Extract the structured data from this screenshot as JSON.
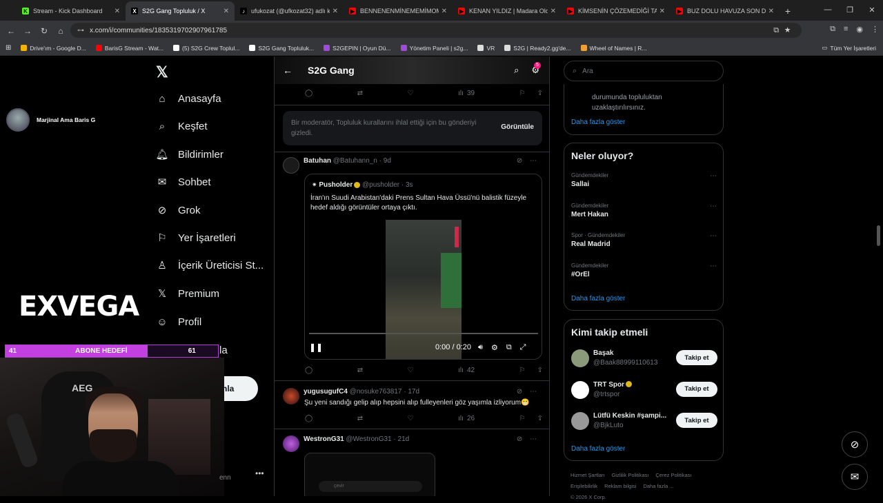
{
  "tabs": [
    {
      "title": "Stream - Kick Dashboard",
      "fav_color": "#53fc18",
      "fav_glyph": "K"
    },
    {
      "title": "S2G Gang Topluluk / X",
      "fav_color": "#000000",
      "fav_glyph": "X"
    },
    {
      "title": "ufukozat (@ufkozat32) adlı kul",
      "fav_color": "#000000",
      "fav_glyph": "♪"
    },
    {
      "title": "BENNENENMİNEMEMİMOMAN",
      "fav_color": "#ff0000",
      "fav_glyph": "▶"
    },
    {
      "title": "KENAN YILDIZ | Madara Olduk",
      "fav_color": "#ff0000",
      "fav_glyph": "▶"
    },
    {
      "title": "KİMSENİN ÇÖZEMEDİĞİ TARİH",
      "fav_color": "#ff0000",
      "fav_glyph": "▶"
    },
    {
      "title": "BUZ DOLU HAVUZA SON DÜŞ",
      "fav_color": "#ff0000",
      "fav_glyph": "▶"
    }
  ],
  "address": "x.com/i/communities/1835319702907961785",
  "bookmarks": [
    {
      "label": "Drive'ım - Google D...",
      "color": "#f4b400"
    },
    {
      "label": "BarisG Stream - Wat...",
      "color": "#ff0000"
    },
    {
      "label": "(5) S2G Crew Toplul...",
      "color": "#ffffff"
    },
    {
      "label": "S2G Gang Topluluk...",
      "color": "#ffffff"
    },
    {
      "label": "S2GEPIN | Oyun Dü...",
      "color": "#a04cd8"
    },
    {
      "label": "Yönetim Paneli | s2g...",
      "color": "#a04cd8"
    },
    {
      "label": "VR",
      "color": "#dddddd"
    },
    {
      "label": "S2G | Ready2.gg'de...",
      "color": "#dddddd"
    },
    {
      "label": "Wheel of Names | R...",
      "color": "#f0a030"
    }
  ],
  "bookmarks_all": "Tüm Yer İşaretleri",
  "nav": [
    {
      "label": "Anasayfa",
      "icon": "⌂",
      "name": "home"
    },
    {
      "label": "Keşfet",
      "icon": "⌕",
      "name": "explore"
    },
    {
      "label": "Bildirimler",
      "icon": "🔔︎",
      "name": "notifications"
    },
    {
      "label": "Sohbet",
      "icon": "✉",
      "name": "chat"
    },
    {
      "label": "Grok",
      "icon": "⊘",
      "name": "grok"
    },
    {
      "label": "Yer İşaretleri",
      "icon": "⚐",
      "name": "bookmarks"
    },
    {
      "label": "İçerik Üreticisi St...",
      "icon": "♙",
      "name": "creator-studio"
    },
    {
      "label": "Premium",
      "icon": "𝕏",
      "name": "premium"
    },
    {
      "label": "Profil",
      "icon": "☺",
      "name": "profile"
    },
    {
      "label": "Daha fazla",
      "icon": "⋯",
      "name": "more"
    }
  ],
  "post_button": "nla",
  "overlay": {
    "username": "Marjinal Ama Baris G",
    "brand": "EXVEGA",
    "goal_current": "41",
    "goal_label": "ABONE HEDEFİ",
    "goal_target": "61",
    "goal_progress": 0.67,
    "webcam_text": "AEG",
    "partial_text": "enn"
  },
  "header": {
    "title": "S2G Gang",
    "badge": "5"
  },
  "top_actions": {
    "views": "39"
  },
  "moderator": {
    "text": "Bir moderatör, Topluluk kurallarını ihlal ettiği için bu gönderiyi gizledi.",
    "button": "Görüntüle"
  },
  "tweets": [
    {
      "name": "Batuhan",
      "handle": "@Batuhann_n",
      "time": "9d",
      "quote": {
        "name": "Pusholder",
        "handle": "@pusholder",
        "time": "3s",
        "text": "İran'ın Suudi Arabistan'daki Prens Sultan Hava Üssü'nü balistik füzeyle hedef aldığı görüntüler ortaya çıktı.",
        "video_time": "0:00 / 0:20"
      },
      "views": "42"
    },
    {
      "name": "yugusugufC4",
      "handle": "@nosuke763817",
      "time": "17d",
      "text": "Şu yeni sandığı gelip alıp  hepsini alıp fulleyenleri göz yaşımla izliyorum😁",
      "views": "26"
    },
    {
      "name": "WestronG31",
      "handle": "@WestronG31",
      "time": "21d",
      "shot_text": "çevir"
    }
  ],
  "search_placeholder": "Ara",
  "rules_text": "durumunda topluluktan uzaklaştırılırsınız.",
  "show_more": "Daha fazla göster",
  "trends_title": "Neler oluyor?",
  "trends": [
    {
      "category": "Gündemdekiler",
      "name": "Sallai"
    },
    {
      "category": "Gündemdekiler",
      "name": "Mert Hakan"
    },
    {
      "category": "Spor · Gündemdekiler",
      "name": "Real Madrid"
    },
    {
      "category": "Gündemdekiler",
      "name": "#OrEl"
    }
  ],
  "who_title": "Kimi takip etmeli",
  "who": [
    {
      "name": "Başak",
      "handle": "@Baak88999110613",
      "verified": false,
      "color": "#8a9a7a"
    },
    {
      "name": "TRT Spor",
      "handle": "@trtspor",
      "verified": true,
      "color": "#ffffff"
    },
    {
      "name": "Lütfü Keskin #şampi...",
      "handle": "@BjkLuto",
      "verified": false,
      "color": "#999999"
    }
  ],
  "follow_label": "Takip et",
  "footer": [
    "Hizmet Şartları",
    "Gizlilik Politikası",
    "Çerez Politikası",
    "Erişilebilirlik",
    "Reklam bilgisi",
    "Daha fazla ..."
  ],
  "footer_copy": "© 2026 X Corp."
}
